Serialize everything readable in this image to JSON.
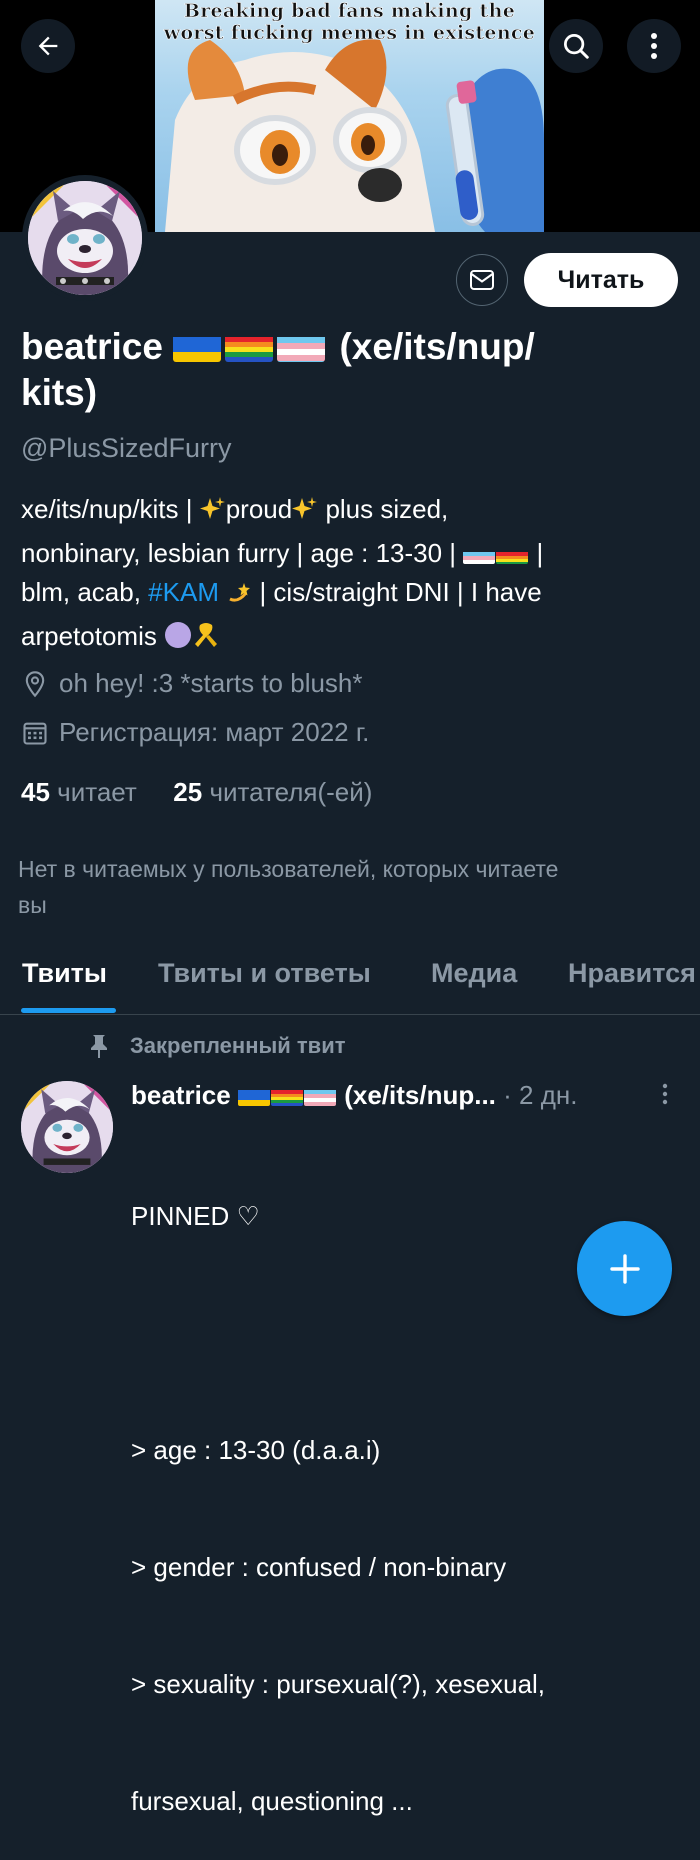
{
  "header": {
    "meme_caption_line1": "Breaking bad fans making the",
    "meme_caption_line2": "worst fucking memes in existence"
  },
  "profile": {
    "follow_label": "Читать",
    "name_text": "beatrice",
    "name_suffix": "(xe/its/nup/",
    "name_suffix2": "kits)",
    "handle": "@PlusSizedFurry",
    "bio": {
      "line1a": "xe/its/nup/kits | ",
      "line1b": "proud",
      "line1c": " plus sized,",
      "line2a": "nonbinary, lesbian furry | age : 13-30 | ",
      "line2b": " |",
      "line3a": "blm, acab, ",
      "hashtag": "#KAM",
      "line3b": " | cis/straight DNI | I have",
      "line4": "arpetotomis "
    },
    "location": "oh hey! :3 *starts to blush*",
    "joined": "Регистрация: март 2022 г.",
    "following_count": "45",
    "following_label": "читает",
    "followers_count": "25",
    "followers_label": "читателя(-ей)",
    "no_mutual_line1": "Нет в читаемых у пользователей, которых читаете",
    "no_mutual_line2": "вы"
  },
  "tabs": [
    "Твиты",
    "Твиты и ответы",
    "Медиа",
    "Нравится"
  ],
  "pinned_tweet": {
    "pinned_label": "Закрепленный твит",
    "name": "beatrice",
    "name_suffix": "(xe/its/nup...",
    "separator": "·",
    "time": "2 дн.",
    "line1": "PINNED ♡",
    "line2": "> age : 13-30 (d.a.a.i)",
    "line3": "> gender : confused / non-binary",
    "line4": "> sexuality : pursexual(?), xesexual,",
    "line5": "fursexual, questioning ..."
  },
  "colors": {
    "background": "#15202b",
    "accent": "#1d9bf0",
    "secondary_text": "#8b98a5"
  },
  "icons": [
    "back-arrow-icon",
    "search-icon",
    "more-vertical-icon",
    "mail-icon",
    "location-icon",
    "calendar-icon",
    "pin-icon",
    "compose-plus-icon"
  ]
}
